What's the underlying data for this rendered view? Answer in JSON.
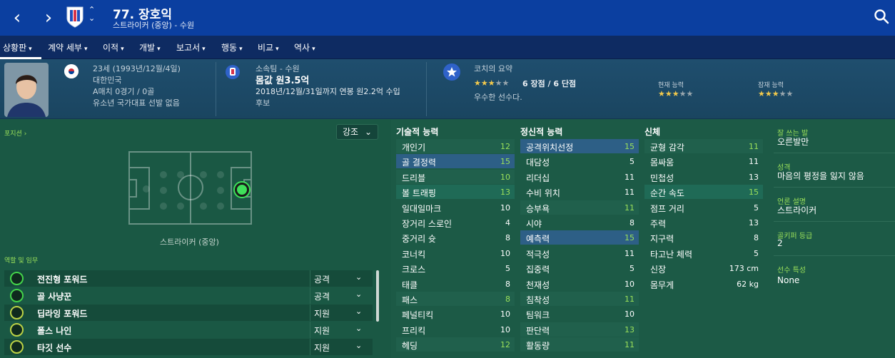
{
  "header": {
    "title": "77. 장호익",
    "subtitle": "스트라이커 (중앙) - 수원"
  },
  "menu": [
    {
      "label": "상황판",
      "chev": "▾"
    },
    {
      "label": "계약 세부",
      "chev": "▾"
    },
    {
      "label": "이적",
      "chev": "▾"
    },
    {
      "label": "개발",
      "chev": "▾"
    },
    {
      "label": "보고서",
      "chev": "▾"
    },
    {
      "label": "행동",
      "chev": "▾"
    },
    {
      "label": "비교",
      "chev": "▾"
    },
    {
      "label": "역사",
      "chev": "▾"
    }
  ],
  "info": {
    "age": "23세",
    "birth": "(1993년/12월/4일)",
    "nation": "대한민국",
    "caps": "A매치 0경기 / 0골",
    "youth": "유소년 국가대표 선발 없음",
    "club_label": "소속팀 - 수원",
    "value": "몸값 원3.5억",
    "contract": "2018년/12월/31일까지 연봉 원2.2억 수입",
    "squad_status": "후보",
    "coach_label": "코치의 요약",
    "coach_summary": "6 장점 / 6 단점",
    "coach_desc": "우수한 선수다.",
    "coach_stars": "3/5",
    "current_label": "현재 능력",
    "current_stars": "3/5",
    "potential_label": "잠재 능력",
    "potential_stars": "3/5"
  },
  "left": {
    "position_label": "포지션 ›",
    "emphasis_label": "강조",
    "position_name": "스트라이커 (중앙)",
    "roles_label": "역할 및 임무",
    "roles": [
      {
        "name": "전진형 포워드",
        "duty": "공격"
      },
      {
        "name": "골 사냥꾼",
        "duty": "공격"
      },
      {
        "name": "딥라잉 포워드",
        "duty": "지원"
      },
      {
        "name": "폴스 나인",
        "duty": "지원"
      },
      {
        "name": "타깃 선수",
        "duty": "지원"
      }
    ]
  },
  "attributes": {
    "technical_label": "기술적 능력",
    "mental_label": "정신적 능력",
    "physical_label": "신체",
    "technical": [
      {
        "name": "개인기",
        "value": "12"
      },
      {
        "name": "골 결정력",
        "value": "15"
      },
      {
        "name": "드리블",
        "value": "10"
      },
      {
        "name": "볼 트래핑",
        "value": "13"
      },
      {
        "name": "일대일마크",
        "value": "10"
      },
      {
        "name": "장거리 스로인",
        "value": "4"
      },
      {
        "name": "중거리 슛",
        "value": "8"
      },
      {
        "name": "코너킥",
        "value": "10"
      },
      {
        "name": "크로스",
        "value": "5"
      },
      {
        "name": "태클",
        "value": "8"
      },
      {
        "name": "패스",
        "value": "8"
      },
      {
        "name": "페널티킥",
        "value": "10"
      },
      {
        "name": "프리킥",
        "value": "10"
      },
      {
        "name": "헤딩",
        "value": "12"
      }
    ],
    "mental": [
      {
        "name": "공격위치선정",
        "value": "15"
      },
      {
        "name": "대담성",
        "value": "5"
      },
      {
        "name": "리더십",
        "value": "11"
      },
      {
        "name": "수비 위치",
        "value": "11"
      },
      {
        "name": "승부욕",
        "value": "11"
      },
      {
        "name": "시야",
        "value": "8"
      },
      {
        "name": "예측력",
        "value": "15"
      },
      {
        "name": "적극성",
        "value": "11"
      },
      {
        "name": "집중력",
        "value": "5"
      },
      {
        "name": "천재성",
        "value": "10"
      },
      {
        "name": "침착성",
        "value": "11"
      },
      {
        "name": "팀워크",
        "value": "10"
      },
      {
        "name": "판단력",
        "value": "13"
      },
      {
        "name": "활동량",
        "value": "11"
      }
    ],
    "physical": [
      {
        "name": "균형 감각",
        "value": "11"
      },
      {
        "name": "몸싸움",
        "value": "11"
      },
      {
        "name": "민첩성",
        "value": "13"
      },
      {
        "name": "순간 속도",
        "value": "15"
      },
      {
        "name": "점프 거리",
        "value": "5"
      },
      {
        "name": "주력",
        "value": "13"
      },
      {
        "name": "지구력",
        "value": "8"
      },
      {
        "name": "타고난 체력",
        "value": "5"
      },
      {
        "name": "신장",
        "value": "173 cm"
      },
      {
        "name": "몸무게",
        "value": "62 kg"
      }
    ]
  },
  "side": {
    "foot_label": "잘 쓰는 발",
    "foot": "오른발만",
    "personality_label": "성격",
    "personality": "마음의 평정을 잃지 않음",
    "media_label": "언론 설명",
    "media": "스트라이커",
    "gk_label": "골키퍼 등급",
    "gk": "2",
    "traits_label": "선수 특성",
    "traits": "None"
  }
}
